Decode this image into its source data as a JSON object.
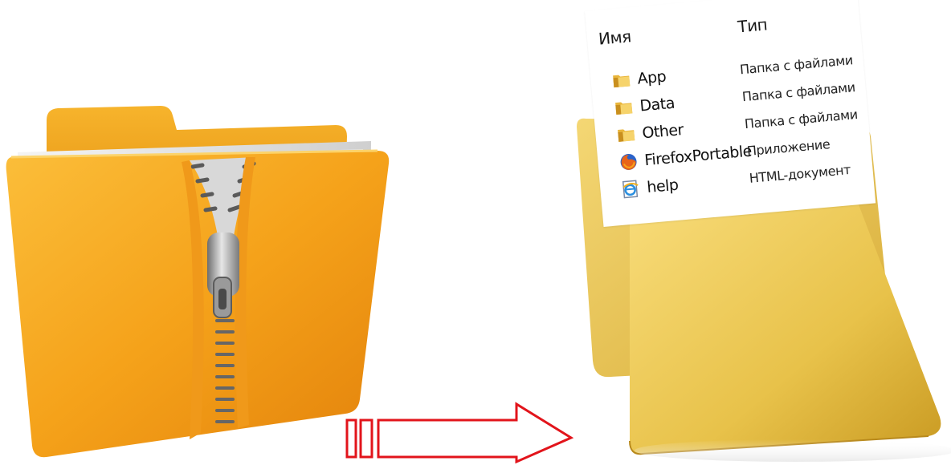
{
  "file_list": {
    "headers": {
      "name": "Имя",
      "type": "Тип"
    },
    "rows": [
      {
        "name": "App",
        "type": "Папка с файлами",
        "icon": "folder-icon"
      },
      {
        "name": "Data",
        "type": "Папка с файлами",
        "icon": "folder-icon"
      },
      {
        "name": "Other",
        "type": "Папка с файлами",
        "icon": "folder-icon"
      },
      {
        "name": "FirefoxPortable",
        "type": "Приложение",
        "icon": "firefox-icon"
      },
      {
        "name": "help",
        "type": "HTML-документ",
        "icon": "ie-document-icon"
      }
    ]
  },
  "colors": {
    "zip_folder": "#f4a71d",
    "open_folder": "#e8c24a",
    "arrow": "#e2141b"
  }
}
